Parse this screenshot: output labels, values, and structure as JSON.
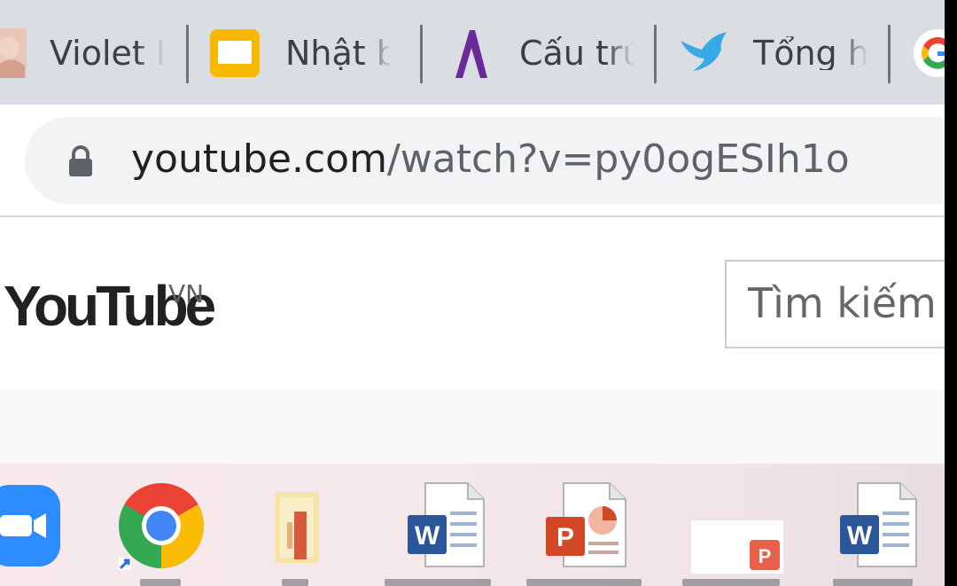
{
  "bookmarks": [
    {
      "label": "Violet I",
      "icon": "violet-favicon-icon"
    },
    {
      "label": "Nhật b",
      "icon": "slides-favicon-icon"
    },
    {
      "label": "Cấu trú",
      "icon": "lambda-favicon-icon"
    },
    {
      "label": "Tổng h",
      "icon": "bird-favicon-icon"
    },
    {
      "label": "",
      "icon": "google-favicon-icon"
    }
  ],
  "omnibox": {
    "host": "youtube.com",
    "path": "/watch?v=py0ogESIh1o",
    "icon": "lock-icon"
  },
  "youtube": {
    "logo_text": "YouTube",
    "country": "VN",
    "search_placeholder": "Tìm kiếm"
  },
  "taskbar": {
    "apps": [
      "zoom-icon",
      "chrome-icon",
      "folder-file-icon",
      "word-doc-icon",
      "powerpoint-doc-icon",
      "powerpoint-file-icon",
      "word-doc-icon"
    ]
  },
  "colors": {
    "bookmark_bar": "#dadde2",
    "omnibox": "#f1f3f4",
    "zoom": "#2d8cff",
    "word": "#2b579a",
    "powerpoint": "#d24726"
  }
}
